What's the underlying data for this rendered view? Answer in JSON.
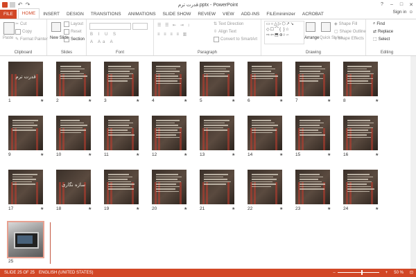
{
  "app": {
    "title": "قدرت ترم.pptx - PowerPoint",
    "signin": "Sign in"
  },
  "tabs": [
    "FILE",
    "HOME",
    "INSERT",
    "DESIGN",
    "TRANSITIONS",
    "ANIMATIONS",
    "SLIDE SHOW",
    "REVIEW",
    "VIEW",
    "ADD-INS",
    "FILEminimizer",
    "ACROBAT"
  ],
  "ribbon": {
    "clipboard": {
      "label": "Clipboard",
      "paste": "Paste",
      "cut": "Cut",
      "copy": "Copy",
      "format_painter": "Format Painter"
    },
    "slides": {
      "label": "Slides",
      "new_slide": "New Slide",
      "layout": "Layout",
      "reset": "Reset",
      "section": "Section"
    },
    "font": {
      "label": "Font"
    },
    "paragraph": {
      "label": "Paragraph",
      "text_direction": "Text Direction",
      "align_text": "Align Text",
      "convert_smartart": "Convert to SmartArt"
    },
    "drawing": {
      "label": "Drawing",
      "arrange": "Arrange",
      "quick_styles": "Quick Styles",
      "shape_fill": "Shape Fill",
      "shape_outline": "Shape Outline",
      "shape_effects": "Shape Effects"
    },
    "editing": {
      "label": "Editing",
      "find": "Find",
      "replace": "Replace",
      "select": "Select"
    }
  },
  "slides": [
    {
      "n": "1",
      "title": "قدرت ترم"
    },
    {
      "n": "2"
    },
    {
      "n": "3"
    },
    {
      "n": "4"
    },
    {
      "n": "5"
    },
    {
      "n": "6"
    },
    {
      "n": "7"
    },
    {
      "n": "8"
    },
    {
      "n": "9"
    },
    {
      "n": "10"
    },
    {
      "n": "11"
    },
    {
      "n": "12"
    },
    {
      "n": "13"
    },
    {
      "n": "14"
    },
    {
      "n": "15"
    },
    {
      "n": "16"
    },
    {
      "n": "17"
    },
    {
      "n": "18",
      "title": "سازه نگاری"
    },
    {
      "n": "19"
    },
    {
      "n": "20"
    },
    {
      "n": "21"
    },
    {
      "n": "22"
    },
    {
      "n": "23"
    },
    {
      "n": "24"
    },
    {
      "n": "25"
    }
  ],
  "status": {
    "slide": "SLIDE 25 OF 25",
    "language": "ENGLISH (UNITED STATES)",
    "zoom": "50 %"
  },
  "colors": {
    "accent": "#d24726",
    "thumb_bg": "#3a3029"
  }
}
